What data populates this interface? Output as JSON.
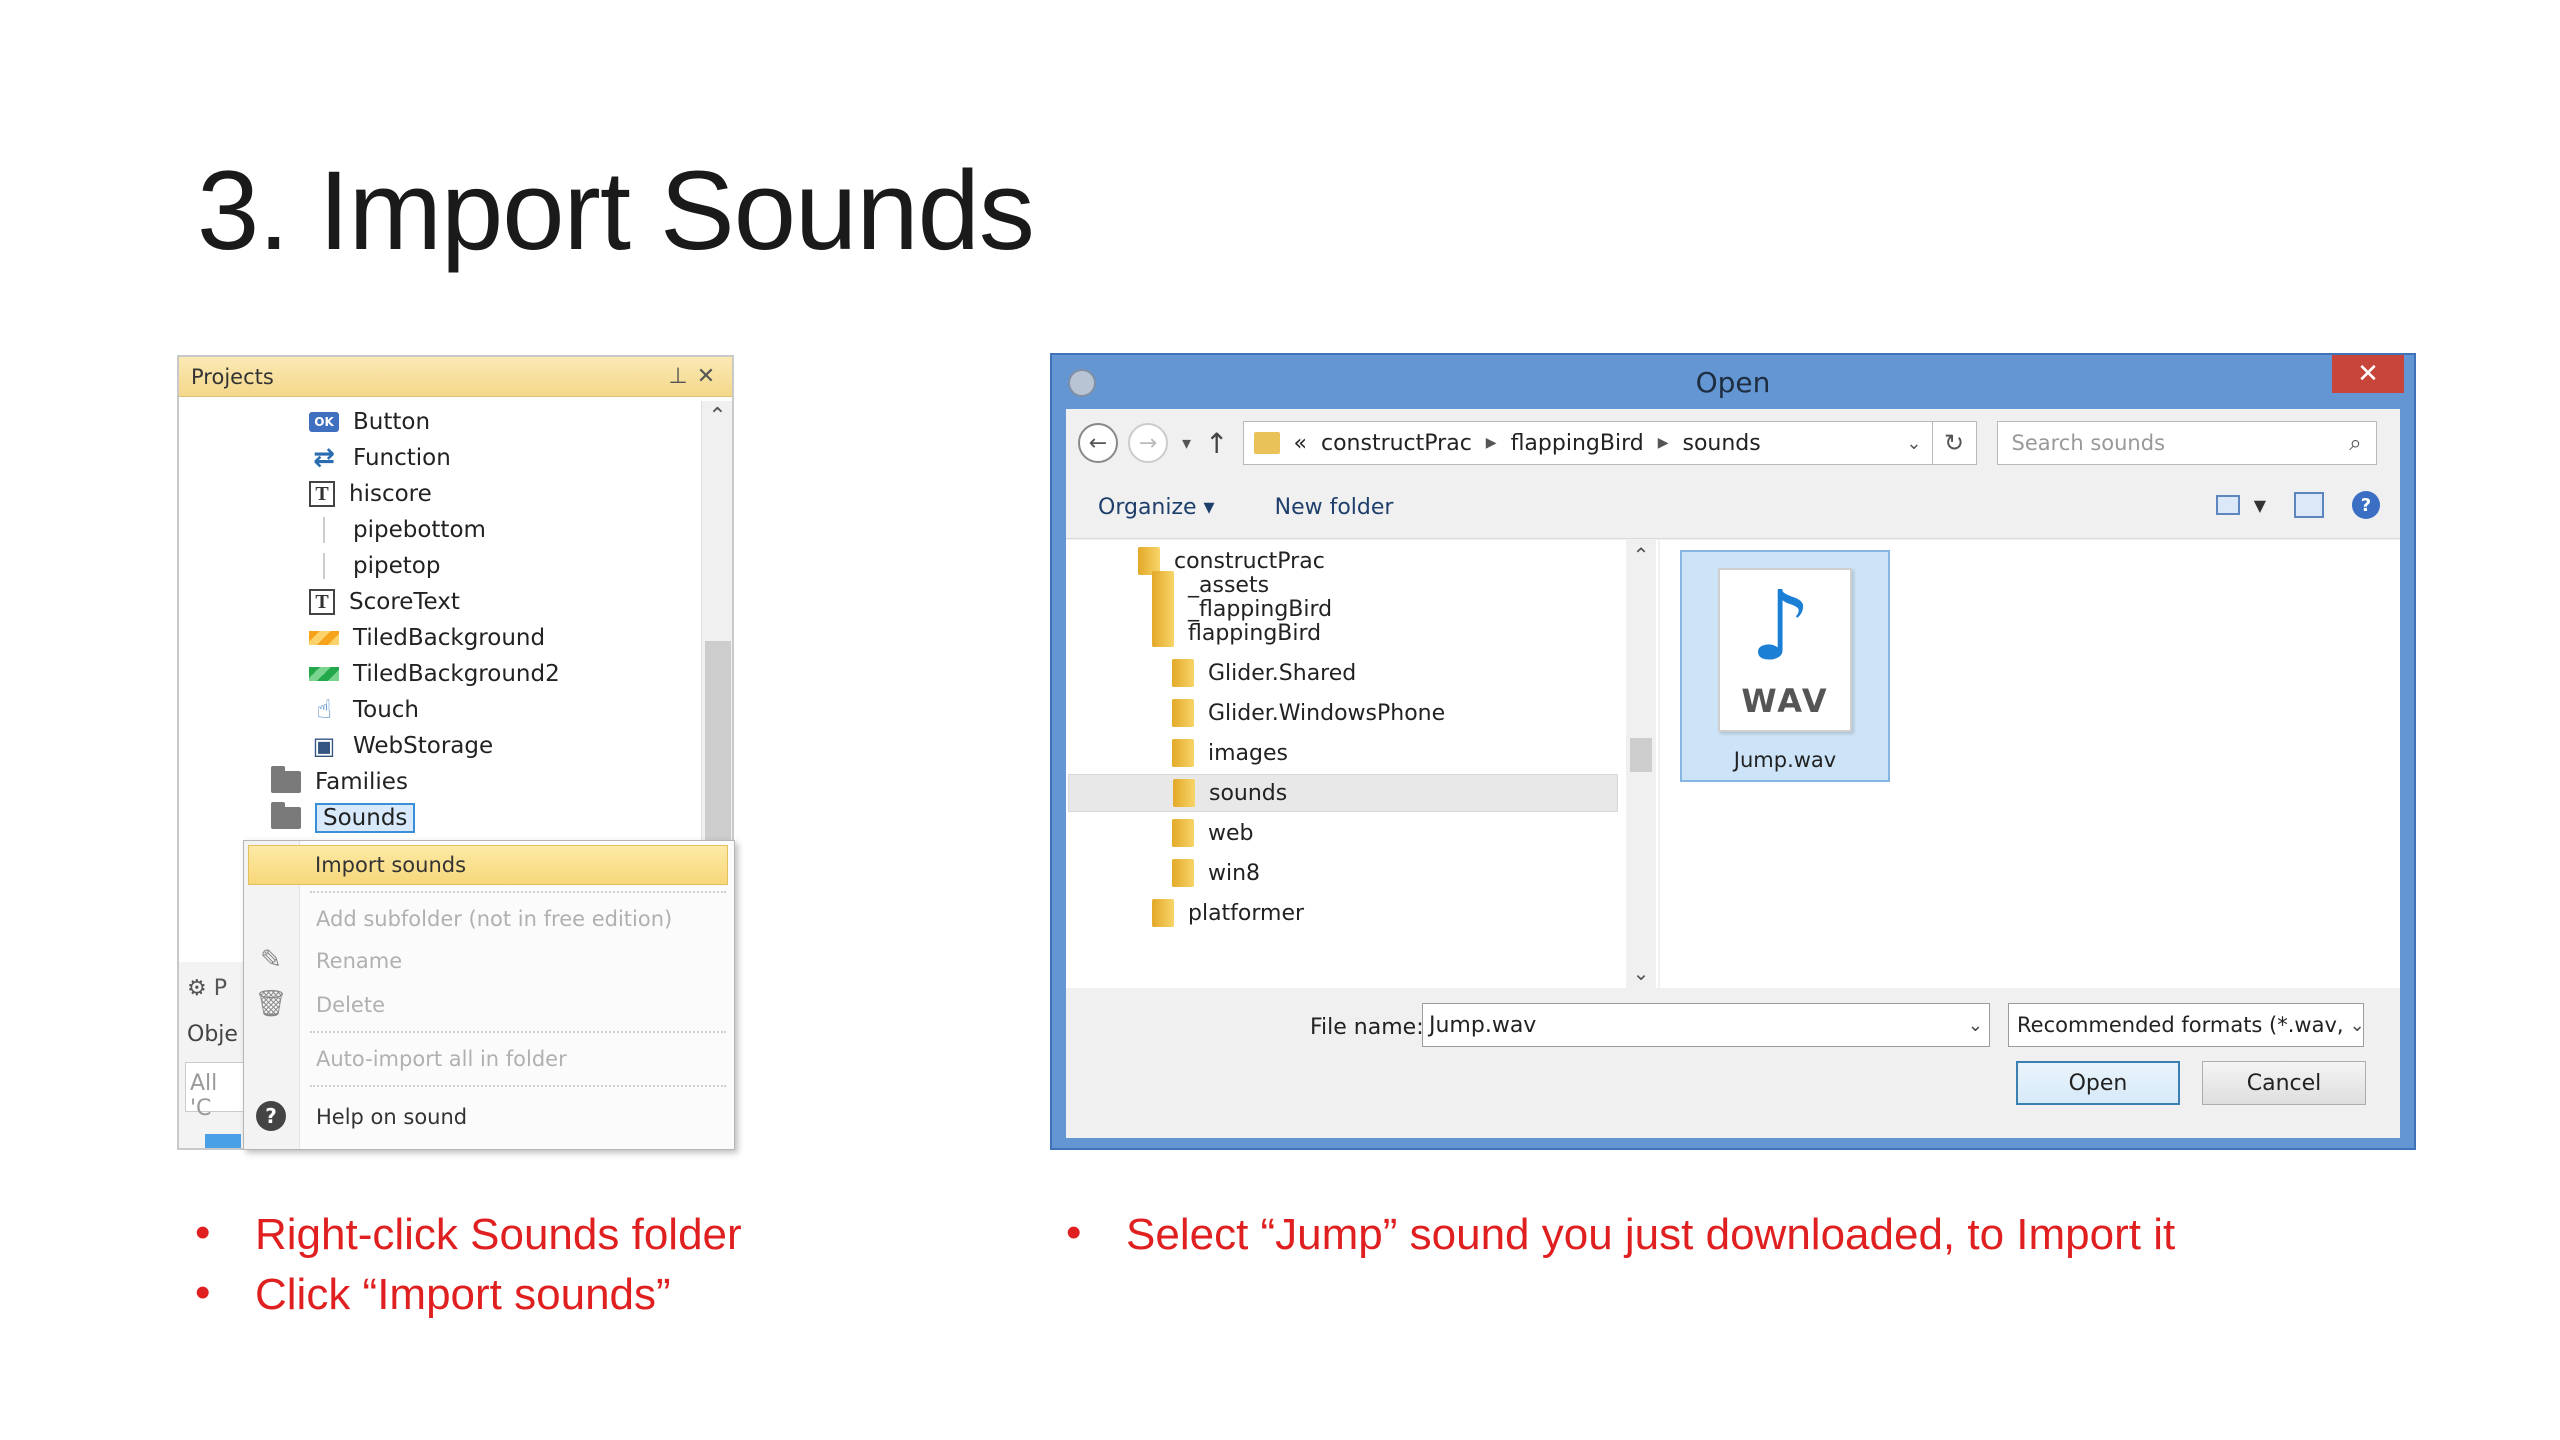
{
  "slide": {
    "title": "3. Import Sounds"
  },
  "projects": {
    "header": "Projects",
    "pin_icon": "pin-icon",
    "close_icon": "close-icon",
    "items": [
      {
        "label": "Button",
        "icon": "button-icon",
        "icon_text": "OK"
      },
      {
        "label": "Function",
        "icon": "function-icon"
      },
      {
        "label": "hiscore",
        "icon": "text-icon"
      },
      {
        "label": "pipebottom",
        "icon": "sprite-icon"
      },
      {
        "label": "pipetop",
        "icon": "sprite-icon"
      },
      {
        "label": "ScoreText",
        "icon": "text-icon"
      },
      {
        "label": "TiledBackground",
        "icon": "tiled-bg-icon"
      },
      {
        "label": "TiledBackground2",
        "icon": "tiled-bg-icon"
      },
      {
        "label": "Touch",
        "icon": "touch-icon"
      },
      {
        "label": "WebStorage",
        "icon": "webstorage-icon"
      },
      {
        "label": "Families",
        "icon": "folder-icon"
      },
      {
        "label": "Sounds",
        "icon": "folder-icon"
      }
    ],
    "bottom": {
      "row1": "P",
      "row2": "Obje",
      "row3": "All 'C"
    }
  },
  "context_menu": {
    "items": [
      {
        "label": "Import sounds",
        "enabled": true
      },
      {
        "label": "Add subfolder (not in free edition)",
        "enabled": false
      },
      {
        "label": "Rename",
        "enabled": false
      },
      {
        "label": "Delete",
        "enabled": false
      },
      {
        "label": "Auto-import all in folder",
        "enabled": false
      },
      {
        "label": "Help on sound",
        "enabled": true
      }
    ]
  },
  "dialog": {
    "title": "Open",
    "close_glyph": "✕",
    "breadcrumb": [
      "«",
      "constructPrac",
      "flappingBird",
      "sounds"
    ],
    "search_placeholder": "Search sounds",
    "toolbar": {
      "organize": "Organize ▾",
      "new_folder": "New folder"
    },
    "folders": [
      {
        "label": "constructPrac",
        "level": 0
      },
      {
        "label": "_assets",
        "level": 1
      },
      {
        "label": "_flappingBird",
        "level": 1
      },
      {
        "label": "flappingBird",
        "level": 1
      },
      {
        "label": "Glider.Shared",
        "level": 2
      },
      {
        "label": "Glider.WindowsPhone",
        "level": 2
      },
      {
        "label": "images",
        "level": 2
      },
      {
        "label": "sounds",
        "level": 2,
        "selected": true
      },
      {
        "label": "web",
        "level": 2
      },
      {
        "label": "win8",
        "level": 2
      },
      {
        "label": "platformer",
        "level": 1
      }
    ],
    "file": {
      "type_label": "WAV",
      "name": "Jump.wav"
    },
    "file_name_label": "File name:",
    "file_name_value": "Jump.wav",
    "filter_value": "Recommended formats (*.wav,",
    "open_button": "Open",
    "cancel_button": "Cancel"
  },
  "bullets_left": [
    "Right-click Sounds folder",
    "Click “Import sounds”"
  ],
  "bullets_right": [
    "Select “Jump” sound you just downloaded, to Import it"
  ],
  "colors": {
    "bullet_red": "#e02020",
    "dialog_frame": "#6496d3",
    "menu_highlight": "#f7d77a",
    "close_red": "#c7453b"
  }
}
